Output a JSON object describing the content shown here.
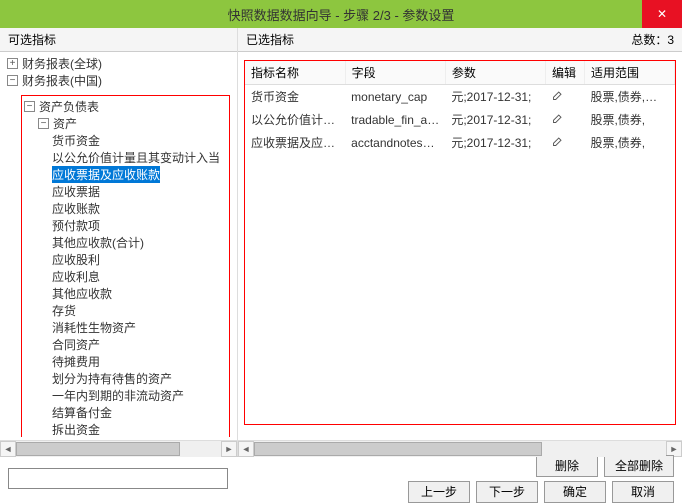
{
  "title": "快照数据数据向导 - 步骤 2/3 - 参数设置",
  "close": "✕",
  "left": {
    "header": "可选指标"
  },
  "right": {
    "header": "已选指标",
    "total_label": "总数：3"
  },
  "tree": {
    "root1": "财务报表(全球)",
    "root2": "财务报表(中国)",
    "n_balance": "资产负债表",
    "n_assets": "资产",
    "items": [
      "货币资金",
      "以公允价值计量且其变动计入当",
      "应收票据及应收账款",
      "应收票据",
      "应收账款",
      "预付款项",
      "其他应收款(合计)",
      "应收股利",
      "应收利息",
      "其他应收款",
      "存货",
      "消耗性生物资产",
      "合同资产",
      "待摊费用",
      "划分为持有待售的资产",
      "一年内到期的非流动资产",
      "结算备付金",
      "拆出资金"
    ],
    "selected_index": 2
  },
  "table": {
    "cols": [
      "指标名称",
      "字段",
      "参数",
      "编辑",
      "适用范围"
    ],
    "rows": [
      {
        "name": "货币资金",
        "field": "monetary_cap",
        "param": "元;2017-12-31;",
        "scope": "股票,债券,指数,"
      },
      {
        "name": "以公允价值计量且",
        "field": "tradable_fin_asse",
        "param": "元;2017-12-31;",
        "scope": "股票,债券,"
      },
      {
        "name": "应收票据及应收账款",
        "field": "acctandnotes_rcv",
        "param": "元;2017-12-31;",
        "scope": "股票,债券,"
      }
    ]
  },
  "buttons": {
    "delete": "删除",
    "delete_all": "全部删除",
    "prev": "上一步",
    "next": "下一步",
    "ok": "确定",
    "cancel": "取消"
  },
  "expander": {
    "plus": "+",
    "minus": "−"
  }
}
